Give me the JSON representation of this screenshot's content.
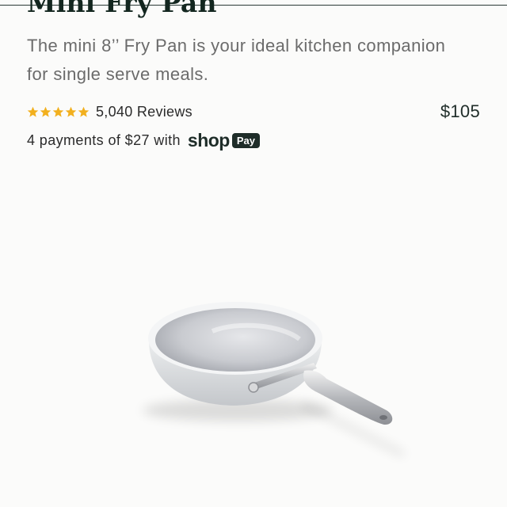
{
  "product": {
    "title": "Mini Fry Pan",
    "description": "The mini 8’’ Fry Pan is your ideal kitchen companion for single serve meals.",
    "rating_stars": 5,
    "reviews_label": "5,040 Reviews",
    "price": "$105",
    "installments_text": "4 payments of $27 with",
    "image_icon": "fry-pan-product-image"
  },
  "shop_pay": {
    "shop_label": "shop",
    "pay_label": "Pay"
  },
  "colors": {
    "star": "#f2b01e",
    "brand_dark": "#1f2d29",
    "background": "#fbfbfa"
  }
}
